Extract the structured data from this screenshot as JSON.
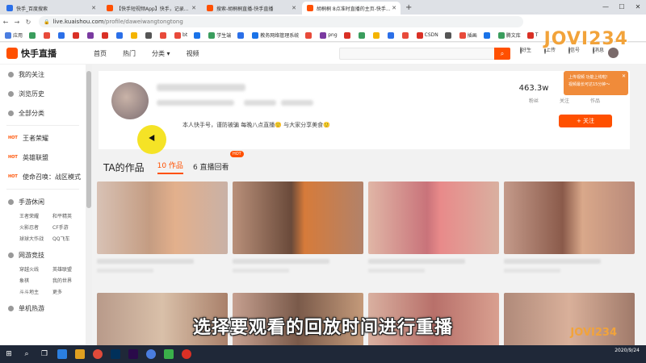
{
  "browser": {
    "tabs": [
      {
        "title": "快手_百度搜索",
        "color": "#2b6fe8",
        "active": false
      },
      {
        "title": "【快手短视频App】快手，记录...",
        "color": "#ff5000",
        "active": false
      },
      {
        "title": "搜索-胡桐桐直播-快手直播",
        "color": "#ff5000",
        "active": false
      },
      {
        "title": "胡桐桐 8点准时直播的主页-快手...",
        "color": "#ff5000",
        "active": true
      }
    ],
    "new_tab": "+",
    "url_host": "live.kuaishou.com",
    "url_path": "/profile/daweiwangtongtong",
    "bookmarks": [
      {
        "label": "应用",
        "color": "#4a7de0"
      },
      {
        "label": "",
        "color": "#3a9d5d"
      },
      {
        "label": "",
        "color": "#e84a3a"
      },
      {
        "label": "",
        "color": "#2b6fe8"
      },
      {
        "label": "",
        "color": "#d93025"
      },
      {
        "label": "",
        "color": "#7a3aa0"
      },
      {
        "label": "",
        "color": "#d93025"
      },
      {
        "label": "",
        "color": "#2b6fe8"
      },
      {
        "label": "",
        "color": "#f4b400"
      },
      {
        "label": "",
        "color": "#555555"
      },
      {
        "label": "",
        "color": "#e84a3a"
      },
      {
        "label": "bt",
        "color": "#e84a3a"
      },
      {
        "label": "",
        "color": "#1a73e8"
      },
      {
        "label": "学生端",
        "color": "#3a9d5d"
      },
      {
        "label": "",
        "color": "#2b6fe8"
      },
      {
        "label": "教务网络管理系统",
        "color": "#1a73e8"
      },
      {
        "label": "",
        "color": "#e84a3a"
      },
      {
        "label": "png",
        "color": "#7a3aa0"
      },
      {
        "label": "",
        "color": "#d93025"
      },
      {
        "label": "",
        "color": "#3a9d5d"
      },
      {
        "label": "",
        "color": "#f4b400"
      },
      {
        "label": "",
        "color": "#2b6fe8"
      },
      {
        "label": "",
        "color": "#e84a3a"
      },
      {
        "label": "CSDN",
        "color": "#d93025"
      },
      {
        "label": "",
        "color": "#555555"
      },
      {
        "label": "插画",
        "color": "#e84a3a"
      },
      {
        "label": "",
        "color": "#1a73e8"
      },
      {
        "label": "腾文库",
        "color": "#3a9d5d"
      },
      {
        "label": "T",
        "color": "#d93025"
      }
    ]
  },
  "watermark": {
    "top": "JOVI234",
    "bottom": "JOVI234"
  },
  "site": {
    "logo": "快手直播",
    "nav": [
      "首页",
      "热门",
      "分类 ▾",
      "视频"
    ],
    "search_icon": "search-icon",
    "header_right": [
      "好生",
      "上传",
      "信号",
      "消息"
    ]
  },
  "sidebar": {
    "top": [
      {
        "label": "我的关注",
        "icon": "heart-icon"
      },
      {
        "label": "浏览历史",
        "icon": "clock-icon"
      },
      {
        "label": "全部分类",
        "icon": "grid-icon"
      }
    ],
    "hot": [
      {
        "label": "王者荣耀",
        "badge": "HOT"
      },
      {
        "label": "英雄联盟",
        "badge": "HOT"
      },
      {
        "label": "使命召唤：战区模式",
        "badge": "HOT"
      }
    ],
    "sections": [
      {
        "label": "手游休闲",
        "subs": [
          "王者荣耀",
          "和平精英",
          "火影忍者",
          "CF手游",
          "球球大作战",
          "QQ飞车"
        ]
      },
      {
        "label": "网游竞技",
        "subs": [
          "穿越火线",
          "英雄联盟",
          "象棋",
          "我的世界",
          "斗斗地主",
          "更多"
        ]
      },
      {
        "label": "单机热游",
        "subs": []
      }
    ]
  },
  "profile": {
    "bio": "本人快手号，谨防被骗   每晚八点直播🙂   与大家分享美食🙂",
    "stats": [
      {
        "value": "463.3w",
        "label": "粉丝"
      },
      {
        "value": "",
        "label": "关注"
      },
      {
        "value": "",
        "label": "作品"
      }
    ],
    "follow_label": "+ 关注",
    "popup": {
      "line1": "上传视频 功能上线啦!",
      "line2": "视频最长可达15分钟～"
    }
  },
  "works": {
    "title": "TA的作品",
    "tabs": [
      {
        "label": "10 作品",
        "active": true
      },
      {
        "label": "6 直播回看",
        "active": false,
        "badge": "HOT"
      }
    ]
  },
  "subtitle": "选择要观看的回放时间进行重播",
  "taskbar": {
    "date": "2020/9/24",
    "time": ""
  }
}
